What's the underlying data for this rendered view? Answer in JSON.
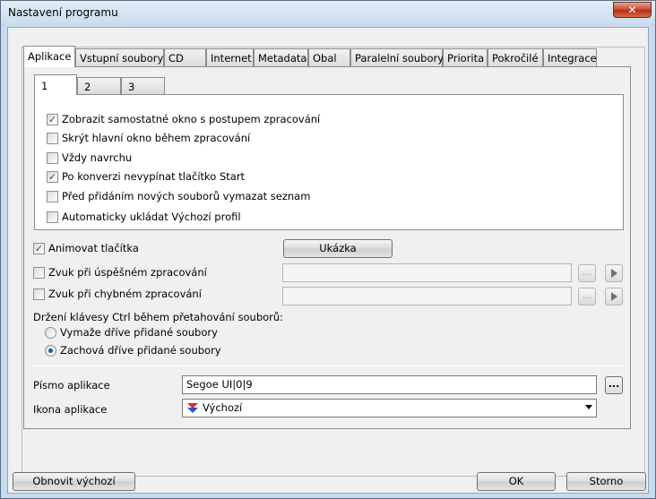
{
  "window": {
    "title": "Nastavení programu",
    "close_glyph": "✕"
  },
  "tabs": [
    {
      "label": "Aplikace",
      "active": true
    },
    {
      "label": "Vstupní soubory"
    },
    {
      "label": "CD"
    },
    {
      "label": "Internet"
    },
    {
      "label": "Metadata"
    },
    {
      "label": "Obal"
    },
    {
      "label": "Paralelní soubory"
    },
    {
      "label": "Priorita"
    },
    {
      "label": "Pokročilé"
    },
    {
      "label": "Integrace"
    }
  ],
  "subtabs": [
    {
      "label": "1",
      "active": true
    },
    {
      "label": "2"
    },
    {
      "label": "3"
    }
  ],
  "options": [
    {
      "label": "Zobrazit samostatné okno s postupem zpracování",
      "checked": true
    },
    {
      "label": "Skrýt hlavní okno během zpracování",
      "checked": false
    },
    {
      "label": "Vždy navrchu",
      "checked": false
    },
    {
      "label": "Po konverzi nevypínat tlačítko Start",
      "checked": true
    },
    {
      "label": "Před přidáním nových souborů vymazat seznam",
      "checked": false
    },
    {
      "label": "Automaticky ukládat Výchozí profil",
      "checked": false
    }
  ],
  "animate": {
    "label": "Animovat tlačítka",
    "checked": true,
    "preview_button": "Ukázka"
  },
  "sounds": [
    {
      "label": "Zvuk při úspěšném zpracování",
      "checked": false,
      "value": "",
      "browse": "...",
      "play_icon": "play-icon"
    },
    {
      "label": "Zvuk při chybném zpracování",
      "checked": false,
      "value": "",
      "browse": "...",
      "play_icon": "play-icon"
    }
  ],
  "ctrl_drag": {
    "label": "Držení klávesy Ctrl během přetahování souborů:",
    "options": [
      {
        "label": "Vymaže dříve přidané soubory",
        "selected": false
      },
      {
        "label": "Zachová dříve přidané soubory",
        "selected": true
      }
    ]
  },
  "font": {
    "label": "Písmo aplikace",
    "value": "Segoe UI|0|9",
    "browse": "..."
  },
  "icon": {
    "label": "Ikona aplikace",
    "value": "Výchozí",
    "icon_name": "flag-icon"
  },
  "footer": {
    "reset": "Obnovit výchozí",
    "ok": "OK",
    "cancel": "Storno"
  },
  "colors": {
    "check": "#2c4c80",
    "radio_dot": "#1f5ba8",
    "play": "#707070"
  }
}
